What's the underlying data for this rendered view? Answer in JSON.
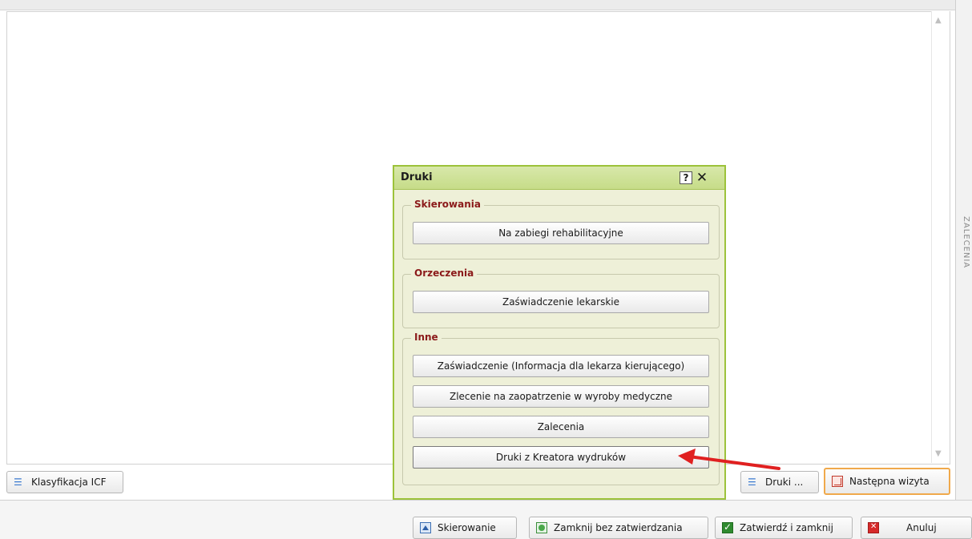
{
  "side_panel": {
    "label": "ZALECENIA"
  },
  "dialog": {
    "title": "Druki",
    "help_label": "?",
    "close_label": "✕",
    "groups": [
      {
        "legend": "Skierowania",
        "buttons": [
          "Na zabiegi rehabilitacyjne"
        ]
      },
      {
        "legend": "Orzeczenia",
        "buttons": [
          "Zaświadczenie lekarskie"
        ]
      },
      {
        "legend": "Inne",
        "buttons": [
          "Zaświadczenie (Informacja dla lekarza kierującego)",
          "Zlecenie na zaopatrzenie w wyroby medyczne",
          "Zalecenia",
          "Druki z Kreatora wydruków"
        ]
      }
    ]
  },
  "tools": {
    "icf_label": "Klasyfikacja ICF",
    "druki_label": "Druki ...",
    "next_visit_label": "Następna wizyta"
  },
  "actions": {
    "skierowanie": "Skierowanie",
    "zamknij_bez": "Zamknij bez zatwierdzania",
    "zatwierdz": "Zatwierdź i zamknij",
    "anuluj": "Anuluj"
  },
  "icons": {
    "icf": "list-icon",
    "druki": "list-icon",
    "next_visit": "calendar-grid-icon",
    "skierowanie": "arrow-up-icon",
    "zamknij_bez": "circle-icon",
    "zatwierdz": "checkmark-icon",
    "anuluj": "cancel-x-icon"
  },
  "colors": {
    "dialog_border": "#9cc23a",
    "dialog_header": "#c6dc88",
    "group_legend": "#8b1a1a",
    "next_visit_highlight": "#f0a94b",
    "annotation_arrow": "#e02020"
  }
}
